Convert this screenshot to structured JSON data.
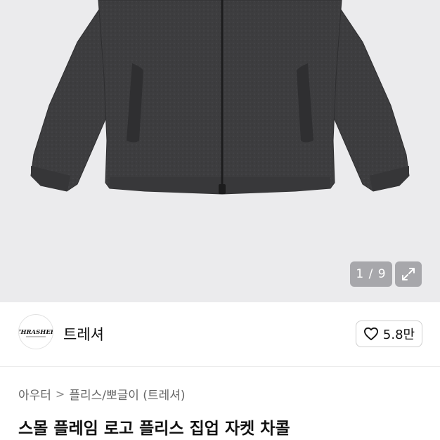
{
  "gallery": {
    "counter": "1 / 9",
    "expand_icon": "expand-icon"
  },
  "seller": {
    "name": "트레셔",
    "logo_text": "THRASHER",
    "like_count": "5.8만",
    "like_icon": "heart-outline-icon"
  },
  "breadcrumb": {
    "category": "아우터",
    "subcategory": "플리스/뽀글이 (트레셔)",
    "separator": ">"
  },
  "product": {
    "title": "스몰 플레임 로고 플리스 집업 자켓 차콜"
  },
  "colors": {
    "hero_bg": "#ebebed",
    "jacket": "#3d3d3f"
  }
}
